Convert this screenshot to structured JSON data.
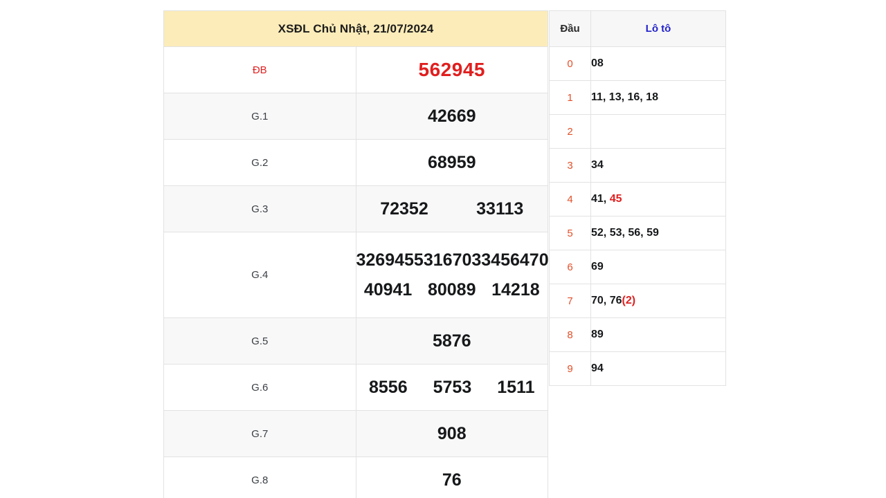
{
  "results": {
    "title": "XSĐL Chủ Nhật, 21/07/2024",
    "rows": [
      {
        "label": "ĐB",
        "numbers": [
          "562945"
        ]
      },
      {
        "label": "G.1",
        "numbers": [
          "42669"
        ]
      },
      {
        "label": "G.2",
        "numbers": [
          "68959"
        ]
      },
      {
        "label": "G.3",
        "numbers": [
          "72352",
          "33113"
        ]
      },
      {
        "label": "G.4",
        "numbers_line1": [
          "32694",
          "55316",
          "70334",
          "56470"
        ],
        "numbers_line2": [
          "40941",
          "80089",
          "14218"
        ]
      },
      {
        "label": "G.5",
        "numbers": [
          "5876"
        ]
      },
      {
        "label": "G.6",
        "numbers": [
          "8556",
          "5753",
          "1511"
        ]
      },
      {
        "label": "G.7",
        "numbers": [
          "908"
        ]
      },
      {
        "label": "G.8",
        "numbers": [
          "76"
        ]
      }
    ]
  },
  "loto": {
    "header": {
      "dau": "Đầu",
      "loto": "Lô tô"
    },
    "rows": [
      {
        "dau": "0",
        "values": "08"
      },
      {
        "dau": "1",
        "values": "11, 13, 16, 18"
      },
      {
        "dau": "2",
        "values": ""
      },
      {
        "dau": "3",
        "values": "34"
      },
      {
        "dau": "4",
        "values_plain": "41, ",
        "values_hot": "45"
      },
      {
        "dau": "5",
        "values": "52, 53, 56, 59"
      },
      {
        "dau": "6",
        "values": "69"
      },
      {
        "dau": "7",
        "values_plain": "70, 76",
        "values_hot": "(2)"
      },
      {
        "dau": "8",
        "values": "89"
      },
      {
        "dau": "9",
        "values": "94"
      }
    ]
  },
  "colors": {
    "header_bg": "#fcecb9",
    "special_red": "#e01f1f",
    "loto_blue": "#2222cc",
    "dau_orange": "#e2502a",
    "row_shade": "#f8f8f8"
  }
}
